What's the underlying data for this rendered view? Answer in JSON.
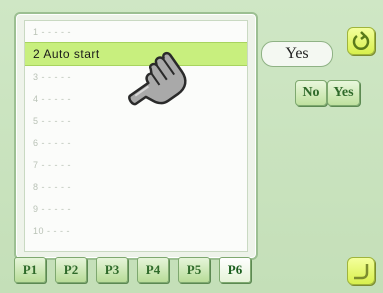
{
  "list": {
    "rows": [
      {
        "label": "1 - - - - -"
      },
      {
        "label": "2 Auto start"
      },
      {
        "label": "3 - - - - -"
      },
      {
        "label": "4 - - - - -"
      },
      {
        "label": "5 - - - - -"
      },
      {
        "label": "6 - - - - -"
      },
      {
        "label": "7 - - - - -"
      },
      {
        "label": "8 - - - - -"
      },
      {
        "label": "9 - - - - -"
      },
      {
        "label": "10 - - - -"
      }
    ],
    "selected_index": 1
  },
  "setting": {
    "current_value": "Yes",
    "no_label": "No",
    "yes_label": "Yes"
  },
  "tabs": [
    {
      "label": "P1"
    },
    {
      "label": "P2"
    },
    {
      "label": "P3"
    },
    {
      "label": "P4"
    },
    {
      "label": "P5"
    },
    {
      "label": "P6"
    }
  ],
  "icons": {
    "top_right": "refresh-icon",
    "bottom_right": "corner-icon",
    "pointer": "hand-pointer-icon"
  },
  "colors": {
    "background": "#c9e3bf",
    "selected_row": "#c8ef7e",
    "button_text": "#2f6a2a",
    "corner_button": "#d8f04d"
  }
}
